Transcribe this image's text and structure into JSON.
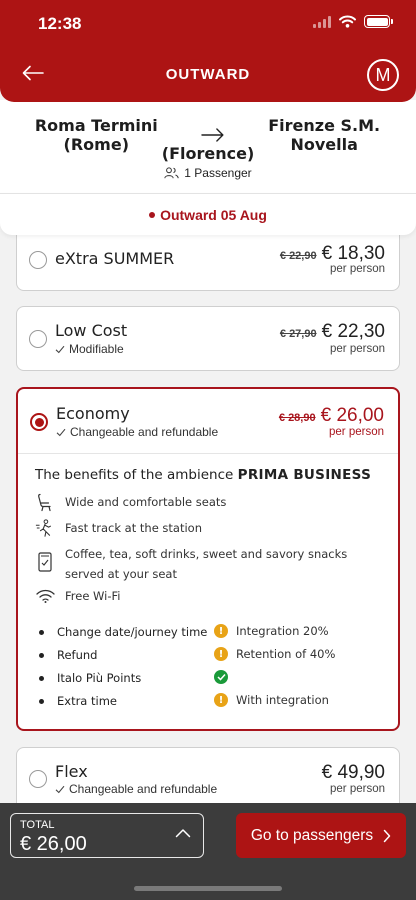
{
  "status_bar": {
    "time": "12:38"
  },
  "nav": {
    "title": "OUTWARD",
    "avatar_initial": "M"
  },
  "route": {
    "origin": "Roma Termini (Rome)",
    "destination": "Firenze S.M. Novella",
    "destination_city": "(Florence)",
    "passengers": "1 Passenger"
  },
  "date": {
    "label": "Outward 05 Aug"
  },
  "offers": [
    {
      "name": "eXtra SUMMER",
      "old_price": "€ 22,90",
      "price": "€ 18,30",
      "per_person": "per person",
      "selected": false
    },
    {
      "name": "Low Cost",
      "subtitle": "Modifiable",
      "old_price": "€ 27,90",
      "price": "€ 22,30",
      "per_person": "per person",
      "selected": false
    },
    {
      "name": "Economy",
      "subtitle": "Changeable and refundable",
      "old_price": "€ 28,90",
      "price": "€ 26,00",
      "per_person": "per person",
      "selected": true
    },
    {
      "name": "Flex",
      "subtitle": "Changeable and refundable",
      "price": "€ 49,90",
      "per_person": "per person",
      "selected": false
    }
  ],
  "benefits": {
    "title_prefix": "The benefits of the ambience ",
    "title_ambience": "PRIMA BUSINESS",
    "items": [
      {
        "icon": "seat-icon",
        "text": "Wide and comfortable seats"
      },
      {
        "icon": "fast-track-icon",
        "text": "Fast track at the station"
      },
      {
        "icon": "snack-icon",
        "text": "Coffee, tea, soft drinks, sweet and savory snacks served at your seat"
      },
      {
        "icon": "wifi-icon",
        "text": "Free Wi-Fi"
      }
    ]
  },
  "conditions": [
    {
      "label": "Change date/journey time",
      "status": "warning",
      "value": "Integration 20%"
    },
    {
      "label": "Refund",
      "status": "warning",
      "value": "Retention of 40%"
    },
    {
      "label": "Italo Più Points",
      "status": "ok",
      "value": ""
    },
    {
      "label": "Extra time",
      "status": "warning",
      "value": "With integration"
    }
  ],
  "footer": {
    "total_label": "TOTAL",
    "total_value": "€ 26,00",
    "cta_label": "Go to passengers"
  },
  "colors": {
    "brand": "#ad1414",
    "warning": "#e8a317",
    "ok": "#1a9a3a",
    "footer": "#3c3c3c"
  }
}
